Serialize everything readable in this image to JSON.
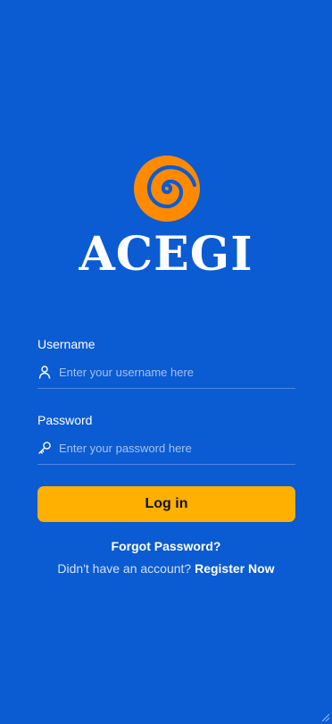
{
  "brand": {
    "name": "ACEGI",
    "logo_icon": "spiral-icon",
    "logo_color": "#ff8a00"
  },
  "form": {
    "username": {
      "label": "Username",
      "placeholder": "Enter your username here",
      "value": "",
      "icon": "user-icon"
    },
    "password": {
      "label": "Password",
      "placeholder": "Enter your password here",
      "value": "",
      "icon": "key-icon"
    },
    "login_label": "Log in"
  },
  "links": {
    "forgot_password": "Forgot Password?",
    "no_account_text": "Didn't have an account?",
    "register": "Register Now"
  },
  "colors": {
    "background": "#0b5bd3",
    "button": "#ffb000",
    "button_text": "#111111"
  }
}
